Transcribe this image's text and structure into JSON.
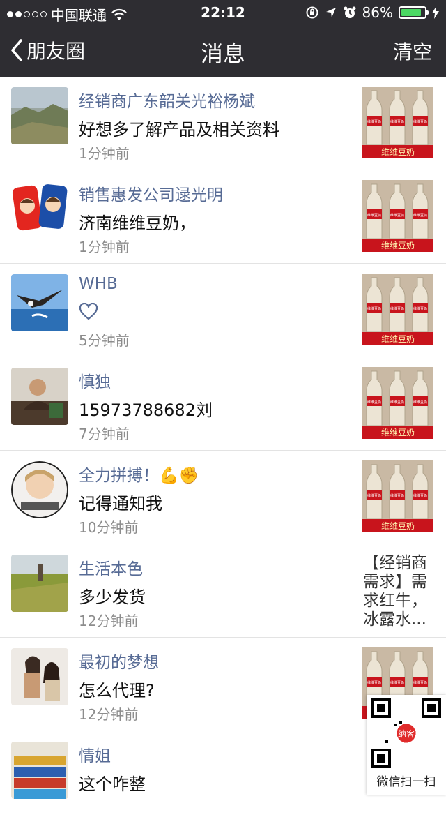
{
  "status_bar": {
    "carrier": "中国联通",
    "time": "22:12",
    "battery_percent": "86%",
    "battery_level": 0.86,
    "signal_bars": 2,
    "icons": [
      "wifi-icon",
      "orientation-lock-icon",
      "location-icon",
      "alarm-icon",
      "battery-icon",
      "charging-icon"
    ]
  },
  "nav": {
    "back_label": "朋友圈",
    "title": "消息",
    "clear_label": "清空"
  },
  "messages": [
    {
      "name": "经销商广东韶关光裕杨斌",
      "message": "好想多了解产品及相关资料",
      "time": "1分钟前"
    },
    {
      "name": "销售惠发公司逯光明",
      "message": "济南维维豆奶，",
      "time": "1分钟前"
    },
    {
      "name": "WHB",
      "message": "",
      "time": "5分钟前",
      "liked": true
    },
    {
      "name": "慎独",
      "message": "15973788682刘",
      "time": "7分钟前"
    },
    {
      "name": "全力拼搏！💪✊",
      "message": "记得通知我",
      "time": "10分钟前"
    },
    {
      "name": "生活本色",
      "message": "多少发货",
      "time": "12分钟前",
      "thumb_text": "【经销商需求】需求红牛，冰露水..."
    },
    {
      "name": "最初的梦想",
      "message": "怎么代理?",
      "time": "12分钟前"
    },
    {
      "name": "情姐",
      "message": "这个咋整",
      "time": ""
    }
  ],
  "product_thumb": {
    "label": "维维豆奶",
    "bottle_label": "维维豆奶"
  },
  "qr_overlay": {
    "caption": "微信扫一扫",
    "badge": "纳客"
  },
  "colors": {
    "nav_bg": "#2e2d32",
    "name": "#576b95",
    "thumb_red": "#c8141c",
    "battery": "#4cd964"
  }
}
